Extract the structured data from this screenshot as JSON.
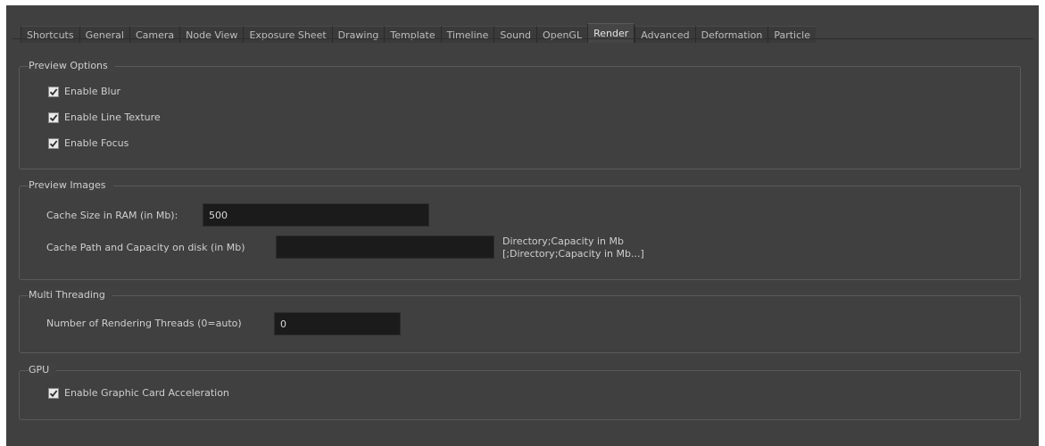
{
  "tabs": [
    {
      "label": "Shortcuts",
      "active": false
    },
    {
      "label": "General",
      "active": false
    },
    {
      "label": "Camera",
      "active": false
    },
    {
      "label": "Node View",
      "active": false
    },
    {
      "label": "Exposure Sheet",
      "active": false
    },
    {
      "label": "Drawing",
      "active": false
    },
    {
      "label": "Template",
      "active": false
    },
    {
      "label": "Timeline",
      "active": false
    },
    {
      "label": "Sound",
      "active": false
    },
    {
      "label": "OpenGL",
      "active": false
    },
    {
      "label": "Render",
      "active": true
    },
    {
      "label": "Advanced",
      "active": false
    },
    {
      "label": "Deformation",
      "active": false
    },
    {
      "label": "Particle",
      "active": false
    }
  ],
  "preview_options": {
    "title": "Preview Options",
    "enable_blur": {
      "label": "Enable Blur",
      "checked": true
    },
    "enable_line_texture": {
      "label": "Enable Line Texture",
      "checked": true
    },
    "enable_focus": {
      "label": "Enable Focus",
      "checked": true
    }
  },
  "preview_images": {
    "title": "Preview Images",
    "cache_size_label": "Cache Size in RAM (in Mb):",
    "cache_size_value": "500",
    "cache_path_label": "Cache Path and Capacity on disk (in Mb)",
    "cache_path_value": "",
    "cache_path_hint_line1": "Directory;Capacity in Mb",
    "cache_path_hint_line2": "[;Directory;Capacity in Mb...]"
  },
  "multi_threading": {
    "title": "Multi Threading",
    "threads_label": "Number of Rendering Threads (0=auto)",
    "threads_value": "0"
  },
  "gpu": {
    "title": "GPU",
    "enable_gpu": {
      "label": "Enable Graphic Card Acceleration",
      "checked": true
    }
  }
}
